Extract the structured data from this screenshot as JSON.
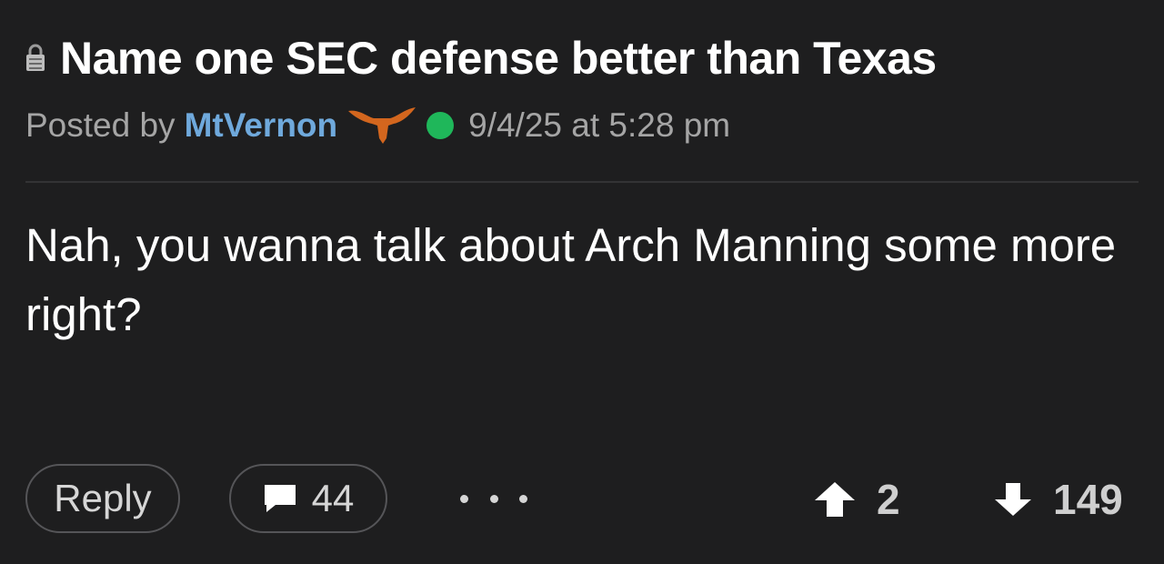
{
  "post": {
    "title": "Name one SEC defense better than Texas",
    "title_icon": "lock-icon",
    "posted_by_prefix": "Posted by",
    "username": "MtVernon",
    "team_icon": "longhorn-logo",
    "online_status_color": "#1fb75a",
    "timestamp": "9/4/25 at 5:28 pm",
    "body": "Nah, you wanna talk about Arch Manning some more right?"
  },
  "actions": {
    "reply_label": "Reply",
    "comment_icon": "comment-icon",
    "comment_count": "44",
    "more_icon": "more-dots-icon",
    "upvote_icon": "arrow-up-icon",
    "upvote_count": "2",
    "downvote_icon": "arrow-down-icon",
    "downvote_count": "149"
  },
  "colors": {
    "background": "#1e1e1f",
    "username": "#6fa9dc",
    "team_logo": "#d3661e"
  }
}
